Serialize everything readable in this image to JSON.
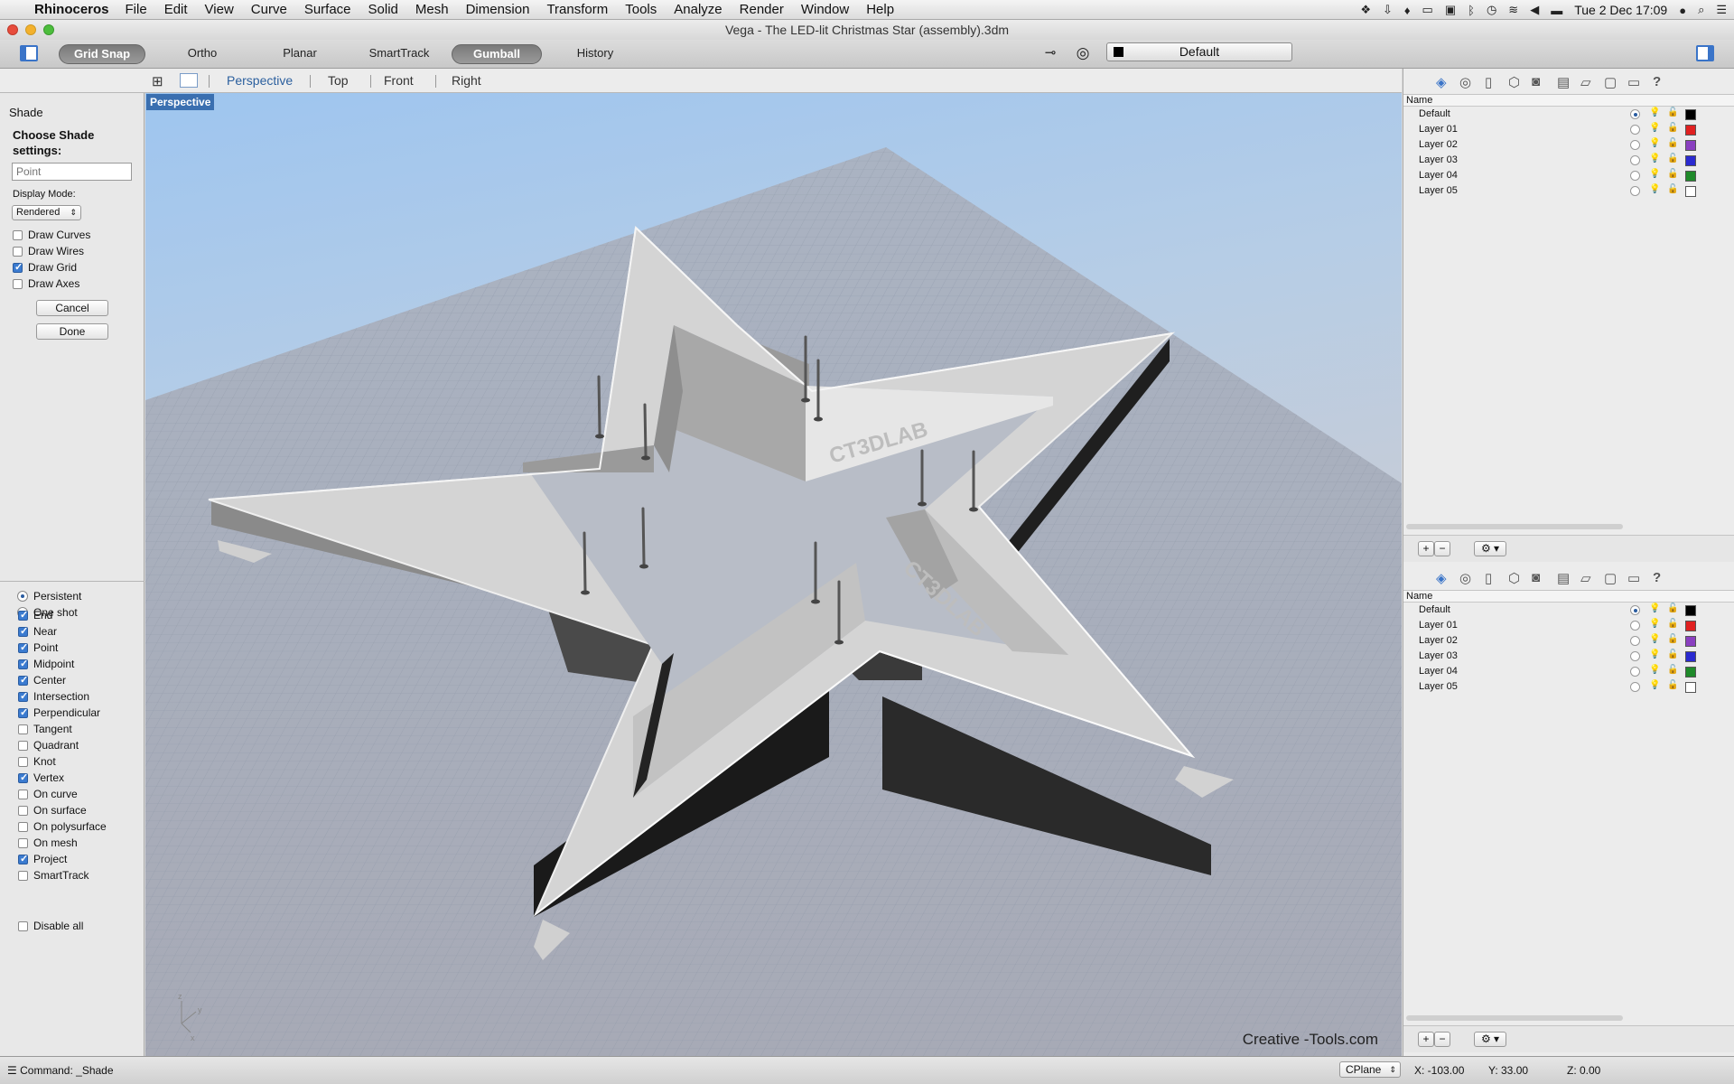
{
  "menubar": {
    "app_name": "Rhinoceros",
    "items": [
      "File",
      "Edit",
      "View",
      "Curve",
      "Surface",
      "Solid",
      "Mesh",
      "Dimension",
      "Transform",
      "Tools",
      "Analyze",
      "Render",
      "Window",
      "Help"
    ],
    "clock": "Tue 2 Dec  17:09"
  },
  "window": {
    "title": "Vega - The LED-lit Christmas Star (assembly).3dm"
  },
  "toolbar": {
    "grid_snap": "Grid Snap",
    "ortho": "Ortho",
    "planar": "Planar",
    "smarttrack": "SmartTrack",
    "gumball": "Gumball",
    "history": "History",
    "layer_current": "Default"
  },
  "viewport_tabs": [
    "Perspective",
    "Top",
    "Front",
    "Right"
  ],
  "shade_panel": {
    "title": "Shade",
    "prompt": "Choose Shade settings:",
    "input_placeholder": "Point",
    "display_mode_label": "Display Mode:",
    "display_mode_value": "Rendered",
    "options": [
      {
        "label": "Draw Curves",
        "checked": false
      },
      {
        "label": "Draw Wires",
        "checked": false
      },
      {
        "label": "Draw Grid",
        "checked": true
      },
      {
        "label": "Draw Axes",
        "checked": false
      }
    ],
    "cancel": "Cancel",
    "done": "Done"
  },
  "osnap": {
    "modes": [
      {
        "label": "Persistent",
        "selected": true
      },
      {
        "label": "One shot",
        "selected": false
      }
    ],
    "items": [
      {
        "label": "End",
        "checked": true
      },
      {
        "label": "Near",
        "checked": true
      },
      {
        "label": "Point",
        "checked": true
      },
      {
        "label": "Midpoint",
        "checked": true
      },
      {
        "label": "Center",
        "checked": true
      },
      {
        "label": "Intersection",
        "checked": true
      },
      {
        "label": "Perpendicular",
        "checked": true
      },
      {
        "label": "Tangent",
        "checked": false
      },
      {
        "label": "Quadrant",
        "checked": false
      },
      {
        "label": "Knot",
        "checked": false
      },
      {
        "label": "Vertex",
        "checked": true
      },
      {
        "label": "On curve",
        "checked": false
      },
      {
        "label": "On surface",
        "checked": false
      },
      {
        "label": "On polysurface",
        "checked": false
      },
      {
        "label": "On mesh",
        "checked": false
      },
      {
        "label": "Project",
        "checked": true
      },
      {
        "label": "SmartTrack",
        "checked": false
      }
    ],
    "disable_all": "Disable all"
  },
  "viewport": {
    "label": "Perspective",
    "watermark": "Creative -Tools.com",
    "embossed_text": "CT3DLAB"
  },
  "layers_panel": {
    "column_name": "Name",
    "layers": [
      {
        "name": "Default",
        "current": true,
        "color": "#000000"
      },
      {
        "name": "Layer 01",
        "current": false,
        "color": "#e02020"
      },
      {
        "name": "Layer 02",
        "current": false,
        "color": "#8a3fc0"
      },
      {
        "name": "Layer 03",
        "current": false,
        "color": "#2a2ad0"
      },
      {
        "name": "Layer 04",
        "current": false,
        "color": "#1f8a2a"
      },
      {
        "name": "Layer 05",
        "current": false,
        "color": "#ffffff"
      }
    ],
    "add": "+",
    "remove": "−",
    "gear": "⚙ ▾"
  },
  "statusbar": {
    "command_label": "Command:",
    "command_value": "_Shade",
    "cplane": "CPlane",
    "x": "X: -103.00",
    "y": "Y: 33.00",
    "z": "Z: 0.00"
  }
}
